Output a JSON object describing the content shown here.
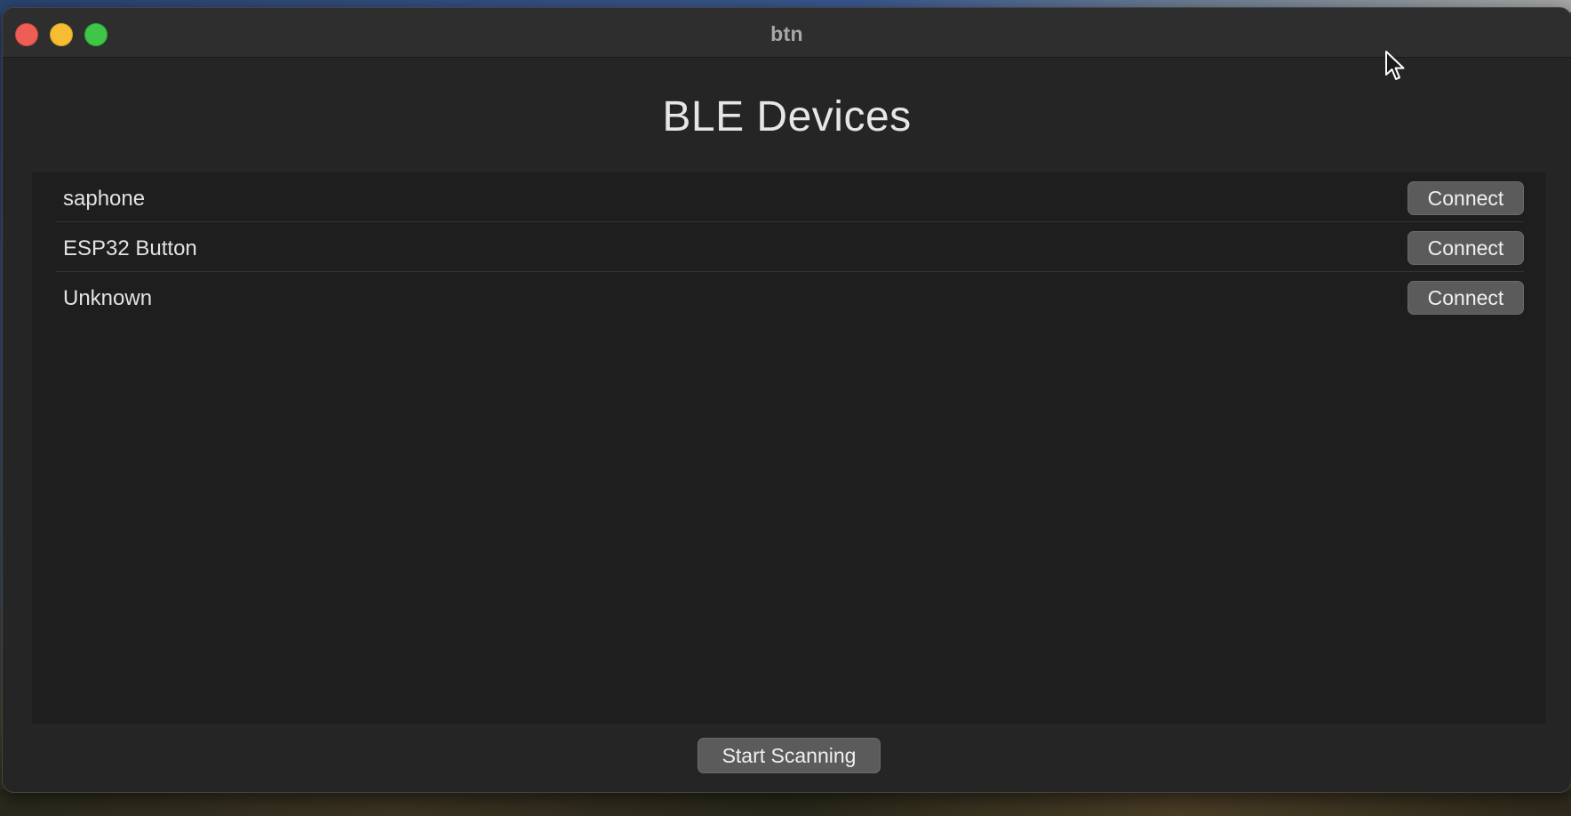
{
  "window": {
    "title": "btn"
  },
  "page": {
    "title": "BLE Devices"
  },
  "devices": [
    {
      "name": "saphone",
      "action_label": "Connect"
    },
    {
      "name": "ESP32 Button",
      "action_label": "Connect"
    },
    {
      "name": "Unknown",
      "action_label": "Connect"
    }
  ],
  "footer": {
    "scan_label": "Start Scanning"
  },
  "icons": {
    "close": "traffic-light-close-icon",
    "minimize": "traffic-light-minimize-icon",
    "zoom": "traffic-light-zoom-icon",
    "cursor": "mouse-pointer-icon"
  },
  "colors": {
    "close": "#ed5f56",
    "minimize": "#f5bd32",
    "zoom": "#3fc648",
    "window_bg": "#252525",
    "list_bg": "#1e1e1e",
    "button_bg": "#5b5b5b"
  }
}
